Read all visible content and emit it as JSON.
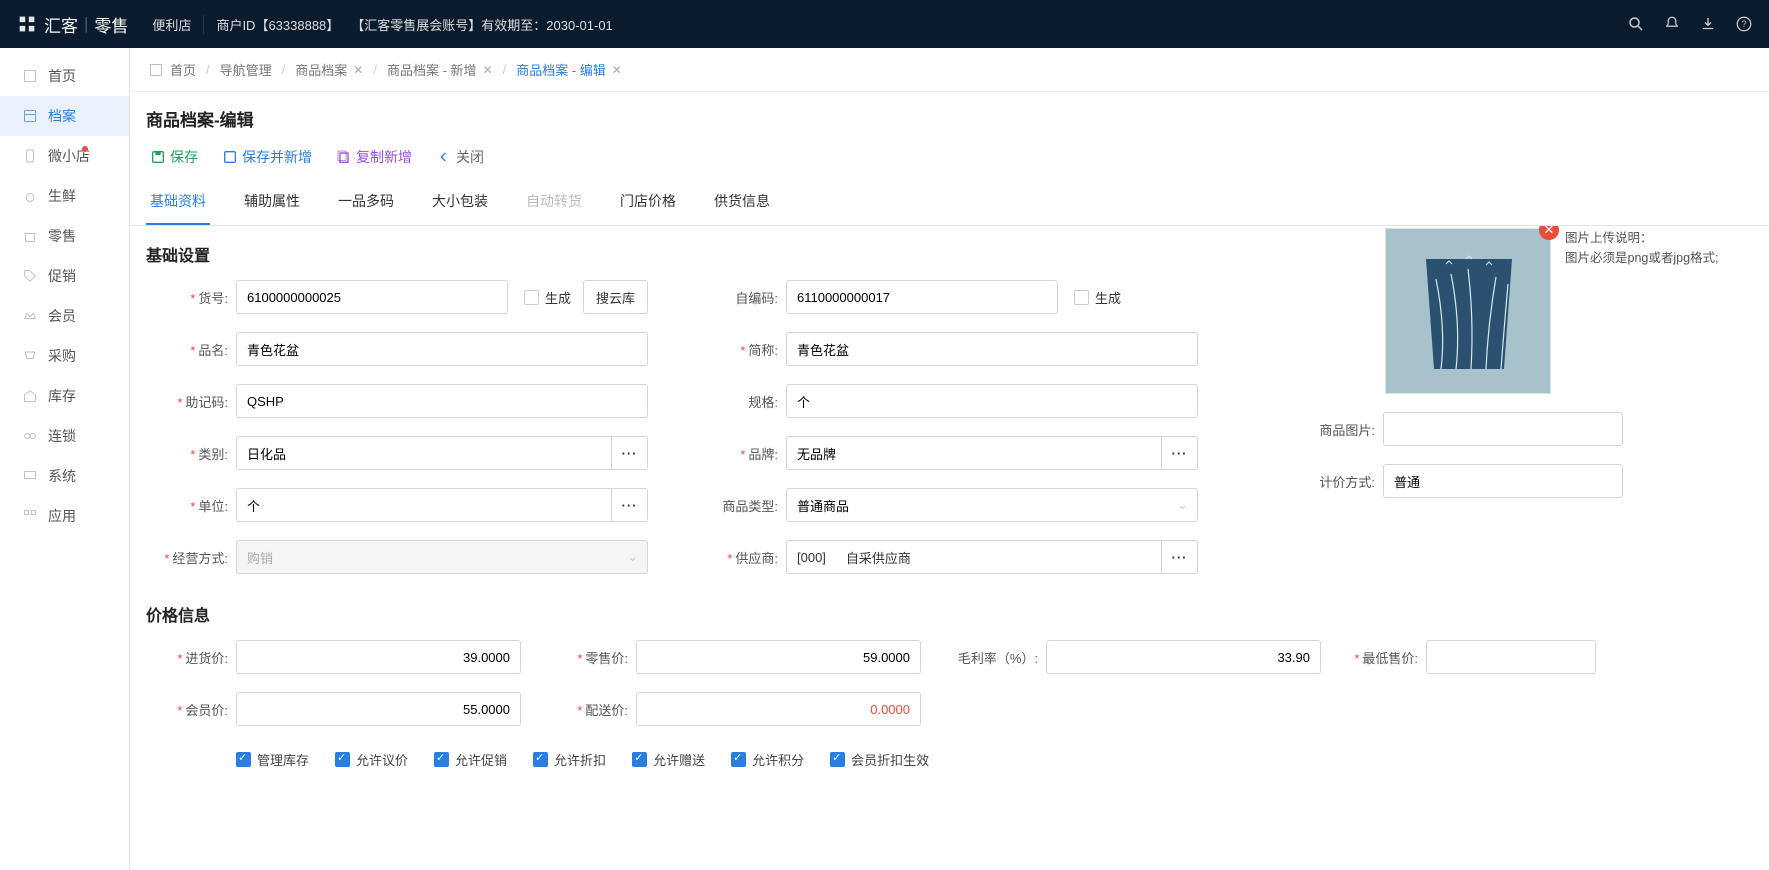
{
  "header": {
    "brand_main": "汇客",
    "brand_sub": "零售",
    "store_type": "便利店",
    "merchant_label": "商户ID【63338888】",
    "account_label": "【汇客零售展会账号】有效期至：2030-01-01"
  },
  "sidebar": [
    "首页",
    "档案",
    "微小店",
    "生鲜",
    "零售",
    "促销",
    "会员",
    "采购",
    "库存",
    "连锁",
    "系统",
    "应用"
  ],
  "crumbs": {
    "home": "首页",
    "items": [
      "导航管理",
      "商品档案",
      "商品档案 - 新增",
      "商品档案 - 编辑"
    ]
  },
  "page_title": "商品档案-编辑",
  "toolbar": {
    "save": "保存",
    "save_add": "保存并新增",
    "copy_add": "复制新增",
    "close": "关闭"
  },
  "tabs": [
    "基础资料",
    "辅助属性",
    "一品多码",
    "大小包装",
    "自动转货",
    "门店价格",
    "供货信息"
  ],
  "section_basic": "基础设置",
  "section_price": "价格信息",
  "labels": {
    "item_no": "货号:",
    "self_code": "自编码:",
    "generate": "生成",
    "cloud": "搜云库",
    "name": "品名:",
    "short": "简称:",
    "mnemonic": "助记码:",
    "spec": "规格:",
    "category": "类别:",
    "brand": "品牌:",
    "unit": "单位:",
    "item_type": "商品类型:",
    "manage_mode": "经营方式:",
    "supplier": "供应商:",
    "image": "商品图片:",
    "price_mode": "计价方式:",
    "purchase": "进货价:",
    "retail": "零售价:",
    "gross": "毛利率（%）:",
    "lowest": "最低售价:",
    "member": "会员价:",
    "delivery": "配送价:"
  },
  "values": {
    "item_no": "6100000000025",
    "self_code": "6110000000017",
    "name": "青色花盆",
    "short": "青色花盆",
    "mnemonic": "QSHP",
    "spec": "个",
    "category": "日化品",
    "brand": "无品牌",
    "unit": "个",
    "item_type": "普通商品",
    "manage_mode": "购销",
    "supplier_code": "[000]",
    "supplier_name": "自采供应商",
    "price_mode": "普通",
    "purchase": "39.0000",
    "retail": "59.0000",
    "gross": "33.90",
    "lowest": "",
    "member": "55.0000",
    "delivery": "0.0000",
    "image_path": ""
  },
  "checks": [
    "管理库存",
    "允许议价",
    "允许促销",
    "允许折扣",
    "允许赠送",
    "允许积分",
    "会员折扣生效"
  ],
  "img_help": {
    "l1": "图片上传说明：",
    "l2": "图片必须是png或者jpg格式;"
  }
}
